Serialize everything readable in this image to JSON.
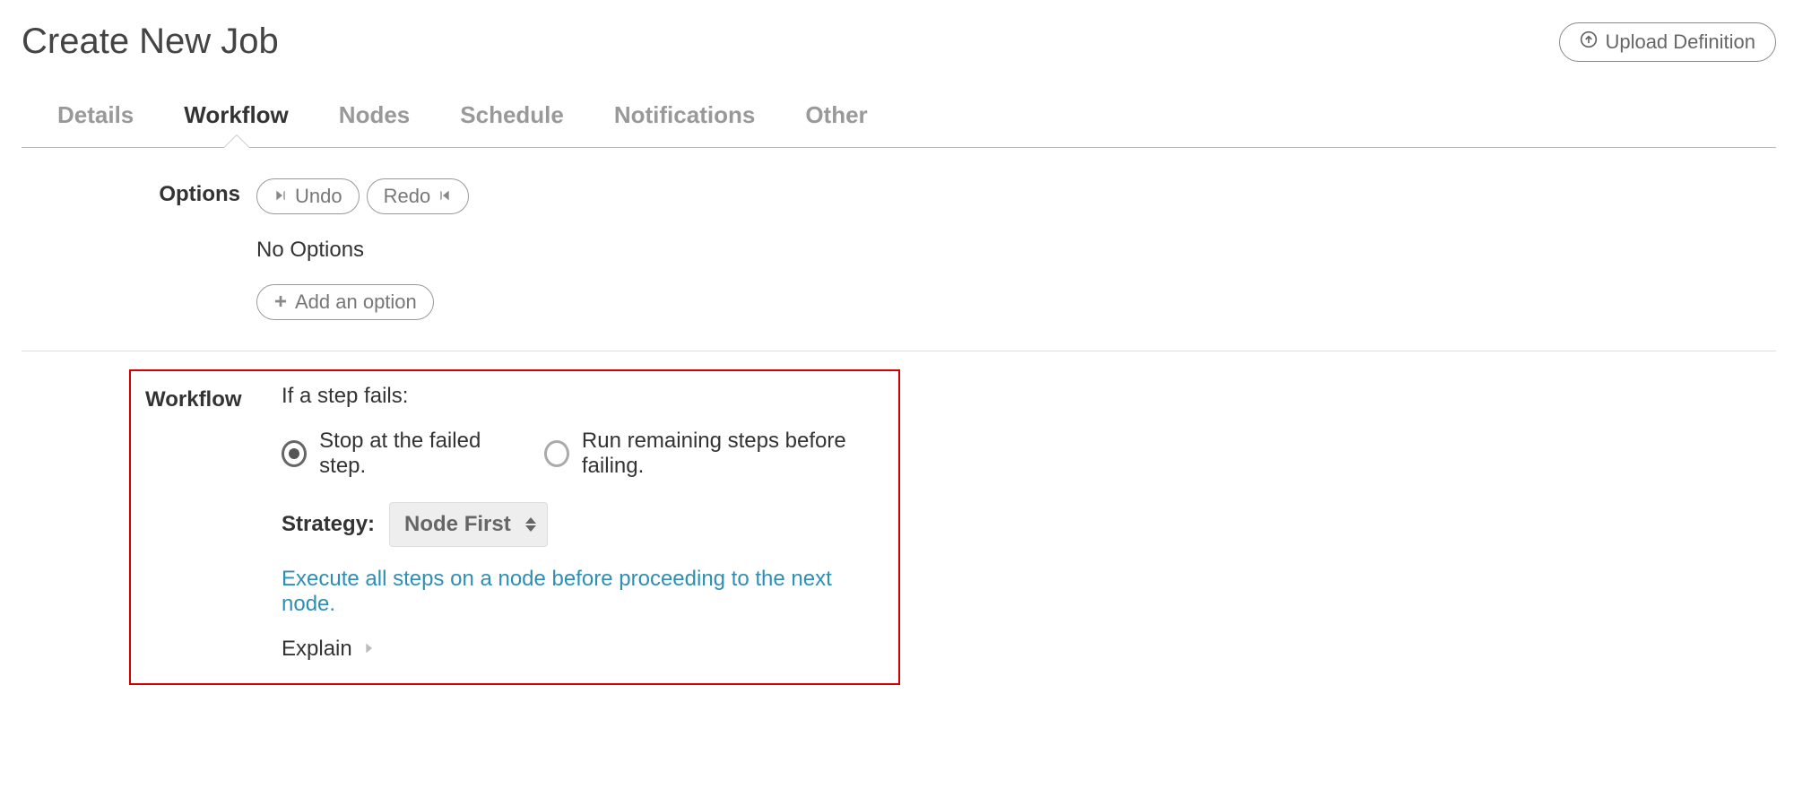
{
  "header": {
    "title": "Create New Job",
    "upload_label": "Upload Definition"
  },
  "tabs": {
    "details": "Details",
    "workflow": "Workflow",
    "nodes": "Nodes",
    "schedule": "Schedule",
    "notifications": "Notifications",
    "other": "Other"
  },
  "options": {
    "section_label": "Options",
    "undo_label": "Undo",
    "redo_label": "Redo",
    "empty_text": "No Options",
    "add_label": "Add an option"
  },
  "workflow": {
    "section_label": "Workflow",
    "prompt": "If a step fails:",
    "radio_stop": "Stop at the failed step.",
    "radio_run": "Run remaining steps before failing.",
    "strategy_label": "Strategy:",
    "strategy_value": "Node First",
    "strategy_desc": "Execute all steps on a node before proceeding to the next node.",
    "explain_label": "Explain"
  }
}
